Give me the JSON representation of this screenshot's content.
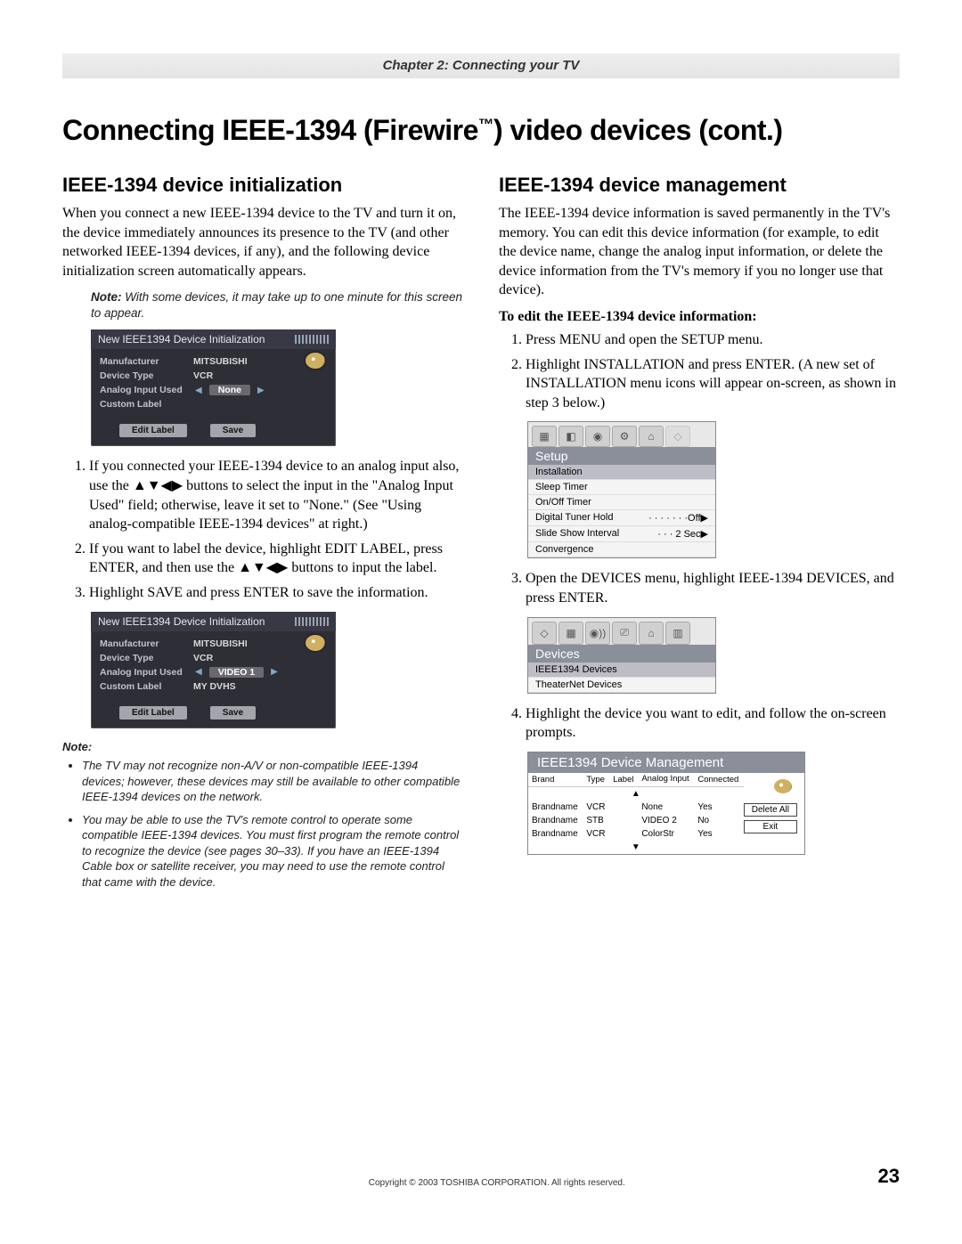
{
  "chapter": "Chapter 2: Connecting your TV",
  "title_html": "Connecting IEEE-1394 (Firewire™) video devices (cont.)",
  "page_number": "23",
  "copyright": "Copyright © 2003 TOSHIBA CORPORATION. All rights reserved.",
  "left": {
    "heading": "IEEE-1394 device initialization",
    "intro": "When you connect a new IEEE-1394 device to the TV and turn it on, the device immediately announces its presence to the TV (and other networked IEEE-1394 devices, if any), and the following device initialization screen automatically appears.",
    "note1_label": "Note:",
    "note1_text": " With some devices, it may take up to one minute for this screen to appear.",
    "osd1": {
      "title": "New IEEE1394 Device Initialization",
      "rows": [
        {
          "k": "Manufacturer",
          "v": "MITSUBISHI"
        },
        {
          "k": "Device Type",
          "v": "VCR"
        },
        {
          "k": "Analog Input Used",
          "sel": "None"
        },
        {
          "k": "Custom Label",
          "v": ""
        }
      ],
      "btn1": "Edit Label",
      "btn2": "Save"
    },
    "steps": [
      "If you connected your IEEE-1394 device to an analog input also, use the ▲▼◀▶ buttons to select the input in the \"Analog Input Used\" field; otherwise, leave it set to \"None.\" (See \"Using analog-compatible IEEE-1394 devices\" at right.)",
      "If you want to label the device, highlight EDIT LABEL, press ENTER, and then use the ▲▼◀▶ buttons to input the label.",
      "Highlight SAVE and press ENTER to save the information."
    ],
    "osd2": {
      "title": "New IEEE1394 Device Initialization",
      "rows": [
        {
          "k": "Manufacturer",
          "v": "MITSUBISHI"
        },
        {
          "k": "Device Type",
          "v": "VCR"
        },
        {
          "k": "Analog Input Used",
          "sel": "VIDEO 1"
        },
        {
          "k": "Custom Label",
          "v": "MY DVHS"
        }
      ],
      "btn1": "Edit Label",
      "btn2": "Save"
    },
    "note2_label": "Note:",
    "note2_bullets": [
      "The TV may not recognize non-A/V or non-compatible IEEE-1394 devices; however, these devices may still be available to other compatible IEEE-1394 devices on the network.",
      "You may be able to use the TV's remote control to operate some compatible IEEE-1394 devices. You must first program the remote control to recognize the device (see pages 30–33). If you have an IEEE-1394 Cable box or satellite receiver, you may need to use the remote control that came with the device."
    ]
  },
  "right": {
    "heading": "IEEE-1394 device management",
    "intro": "The IEEE-1394 device information is saved permanently in the TV's memory. You can edit this device information (for example, to edit the device name, change the analog input information, or delete the device information from the TV's memory if you no longer use that device).",
    "edit_heading": "To edit the IEEE-1394 device information:",
    "steps12": [
      "Press MENU and open the SETUP menu.",
      "Highlight INSTALLATION and press ENTER. (A new set of INSTALLATION menu icons will appear on-screen, as shown in step 3 below.)"
    ],
    "setup": {
      "header": "Setup",
      "items": [
        {
          "label": "Installation",
          "sel": true
        },
        {
          "label": "Sleep Timer"
        },
        {
          "label": "On/Off Timer"
        },
        {
          "label": "Digital Tuner Hold",
          "right": "· · · · · · ·Off▶"
        },
        {
          "label": "Slide Show Interval",
          "right": "· · · 2 Sec▶"
        },
        {
          "label": "Convergence"
        }
      ]
    },
    "step3": "Open the DEVICES menu, highlight IEEE-1394 DEVICES, and press ENTER.",
    "devices": {
      "header": "Devices",
      "items": [
        {
          "label": "IEEE1394 Devices",
          "sel": true
        },
        {
          "label": "TheaterNet Devices"
        }
      ]
    },
    "step4": "Highlight the device you want to edit, and follow the on-screen prompts.",
    "devmgmt": {
      "header": "IEEE1394 Device Management",
      "cols": [
        "Brand",
        "Type",
        "Label",
        "Analog Input",
        "Connected"
      ],
      "rows": [
        [
          "Brandname",
          "VCR",
          "",
          "None",
          "Yes"
        ],
        [
          "Brandname",
          "STB",
          "",
          "VIDEO 2",
          "No"
        ],
        [
          "Brandname",
          "VCR",
          "",
          "ColorStr",
          "Yes"
        ]
      ],
      "btn_delete": "Delete All",
      "btn_exit": "Exit"
    }
  }
}
